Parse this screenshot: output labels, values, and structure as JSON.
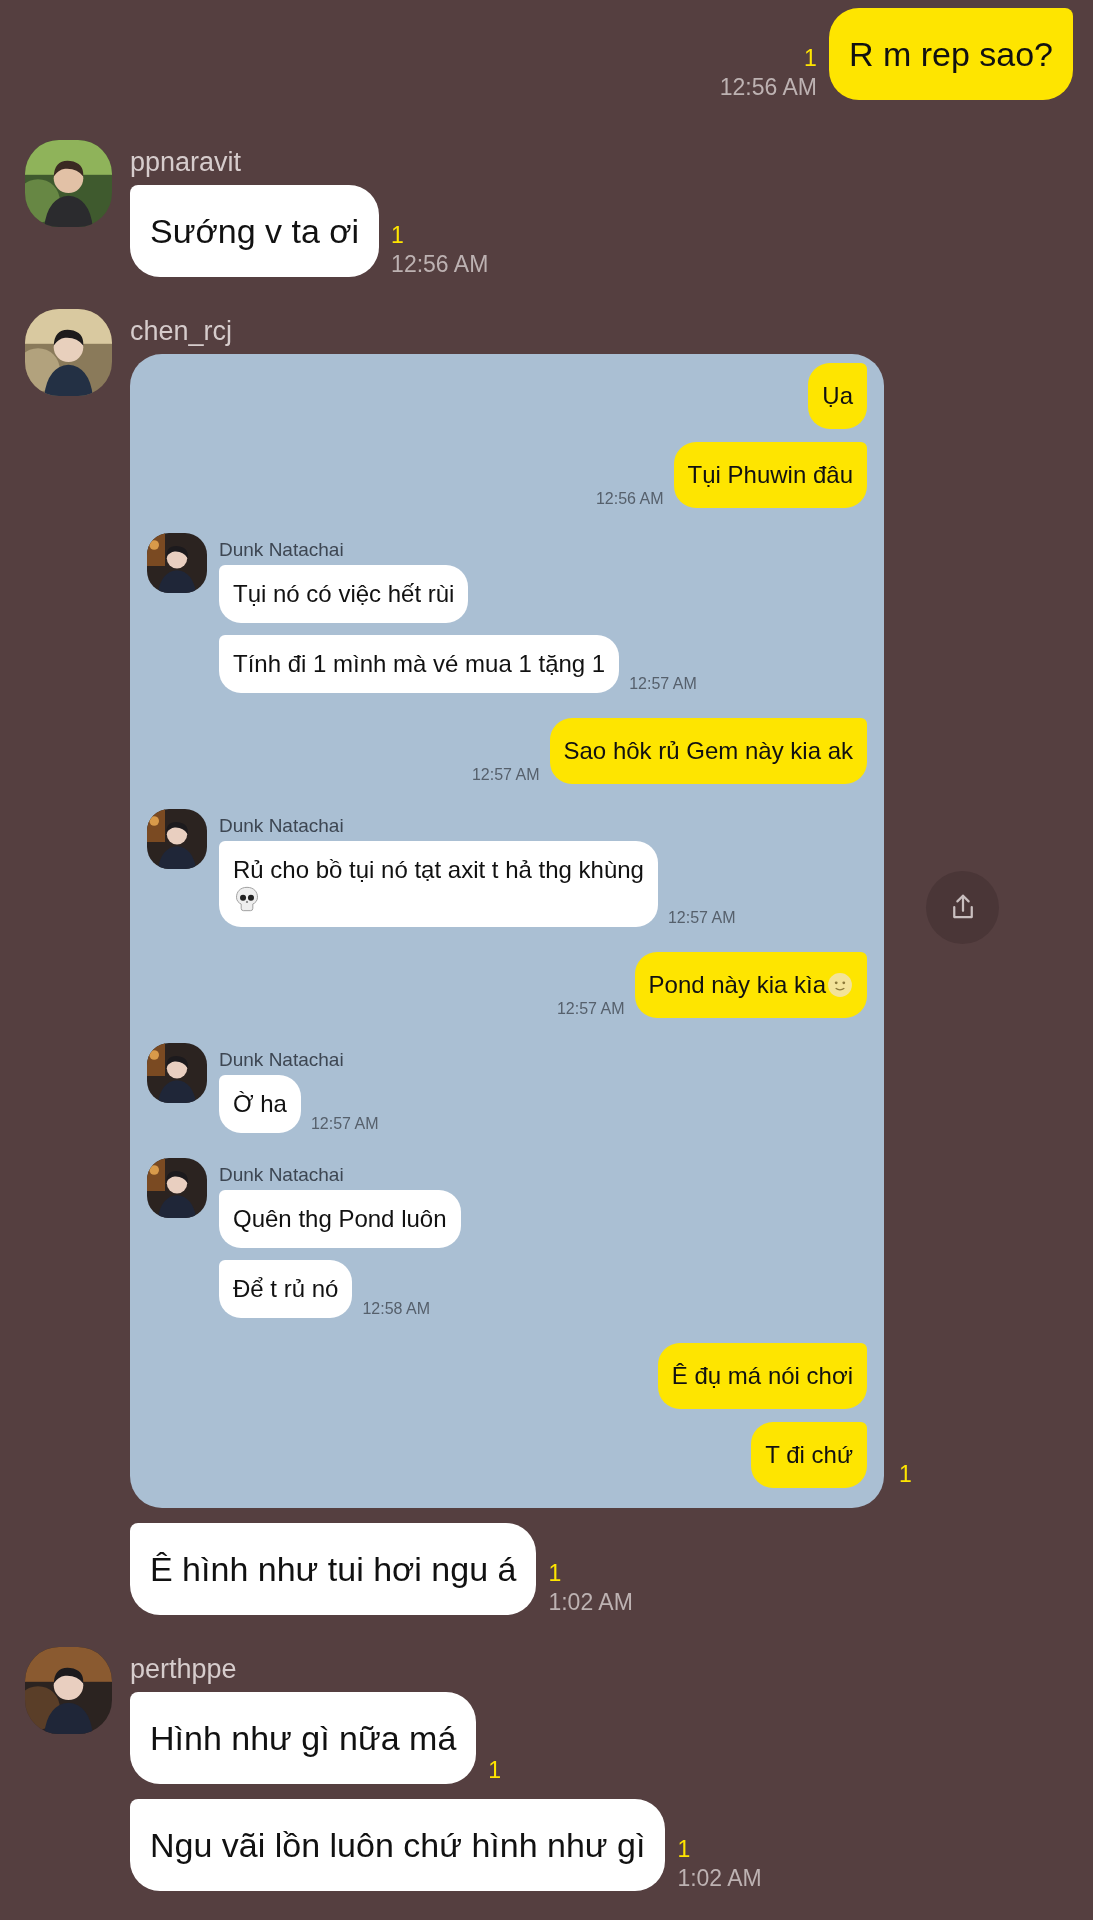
{
  "messages": [
    {
      "kind": "sent",
      "bubbles": [
        {
          "kind": "text",
          "text": "R m rep sao?",
          "unread": "1",
          "time": "12:56 AM"
        }
      ]
    },
    {
      "kind": "received",
      "sender": "ppnaravit",
      "bubbles": [
        {
          "kind": "text",
          "text": "Sướng v ta ơi",
          "unread": "1",
          "time": "12:56 AM"
        }
      ]
    },
    {
      "kind": "received",
      "sender": "chen_rcj",
      "bubbles": [
        {
          "kind": "screenshot",
          "unread": "1",
          "screenshot": {
            "messages": [
              {
                "kind": "sent",
                "bubbles": [
                  {
                    "text": "Ụa"
                  },
                  {
                    "text": "Tụi Phuwin đâu",
                    "time": "12:56 AM"
                  }
                ]
              },
              {
                "kind": "received",
                "sender": "Dunk Natachai",
                "bubbles": [
                  {
                    "text": "Tụi nó có việc hết rùi"
                  },
                  {
                    "text": "Tính đi 1 mình mà vé mua 1 tặng 1",
                    "time": "12:57 AM"
                  }
                ]
              },
              {
                "kind": "sent",
                "bubbles": [
                  {
                    "text": "Sao hôk rủ Gem này kia ak",
                    "time": "12:57 AM"
                  }
                ]
              },
              {
                "kind": "received",
                "sender": "Dunk Natachai",
                "bubbles": [
                  {
                    "kind": "skull",
                    "text": "Rủ cho bồ tụi nó tạt axit t hả thg khùng",
                    "time": "12:57 AM"
                  }
                ]
              },
              {
                "kind": "sent",
                "bubbles": [
                  {
                    "kind": "smiley",
                    "text": "Pond này kia kìa",
                    "time": "12:57 AM"
                  }
                ]
              },
              {
                "kind": "received",
                "sender": "Dunk Natachai",
                "bubbles": [
                  {
                    "text": "Ờ ha",
                    "time": "12:57 AM"
                  }
                ]
              },
              {
                "kind": "received",
                "sender": "Dunk Natachai",
                "bubbles": [
                  {
                    "text": "Quên thg Pond luôn"
                  },
                  {
                    "text": "Để t rủ nó",
                    "time": "12:58 AM"
                  }
                ]
              },
              {
                "kind": "sent",
                "bubbles": [
                  {
                    "text": "Ê đụ má nói chơi"
                  },
                  {
                    "text": "T đi chứ"
                  }
                ]
              }
            ]
          }
        },
        {
          "kind": "text",
          "text": "Ê hình như tui hơi ngu á",
          "unread": "1",
          "time": "1:02 AM"
        }
      ]
    },
    {
      "kind": "received",
      "sender": "perthppe",
      "bubbles": [
        {
          "kind": "text",
          "text": "Hình như gì nữa má",
          "unread": "1"
        },
        {
          "kind": "text",
          "text": "Ngu vãi lồn luôn chứ hình như gì",
          "unread": "1",
          "time": "1:02 AM"
        }
      ]
    }
  ]
}
